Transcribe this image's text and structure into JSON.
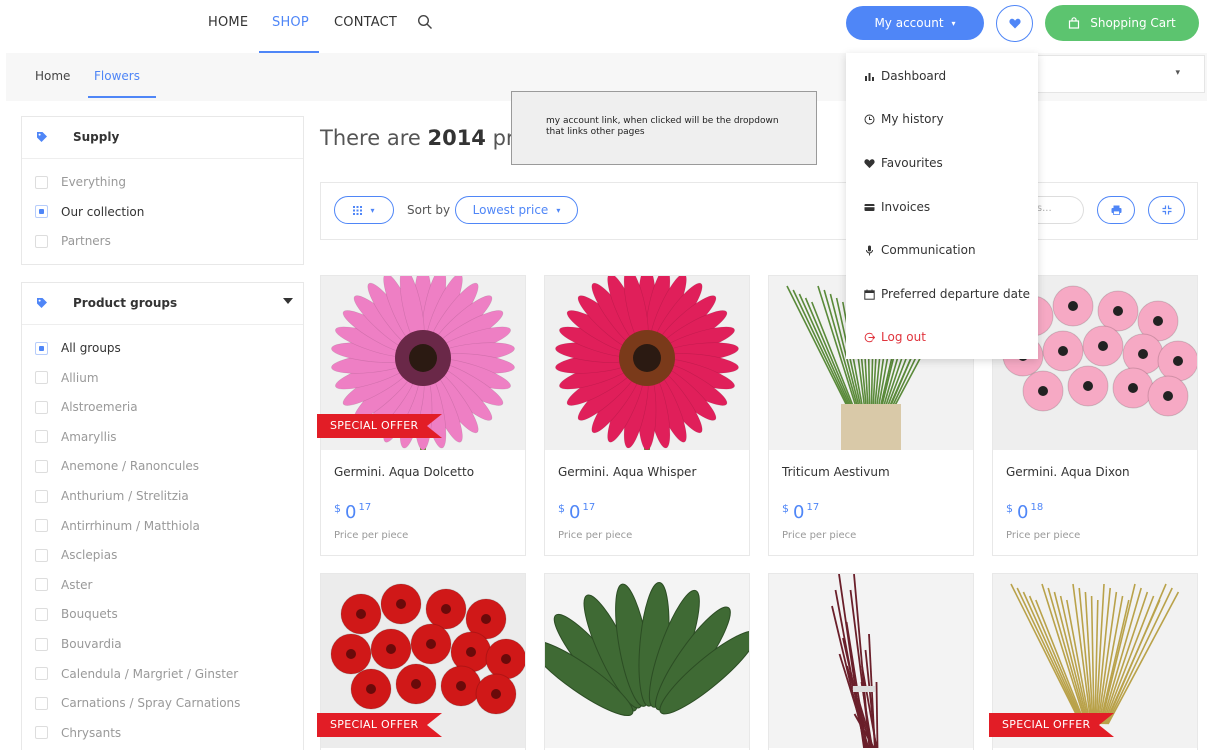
{
  "nav": {
    "links": [
      "HOME",
      "SHOP",
      "CONTACT"
    ],
    "account_label": "My account",
    "cart_label": "Shopping Cart"
  },
  "breadcrumb": [
    "Home",
    "Flowers"
  ],
  "sidebar": {
    "supply": {
      "title": "Supply",
      "options": [
        {
          "label": "Everything",
          "checked": false
        },
        {
          "label": "Our collection",
          "checked": true
        },
        {
          "label": "Partners",
          "checked": false
        }
      ]
    },
    "groups": {
      "title": "Product groups",
      "options": [
        {
          "label": "All groups",
          "checked": true
        },
        {
          "label": "Allium",
          "checked": false
        },
        {
          "label": "Alstroemeria",
          "checked": false
        },
        {
          "label": "Amaryllis",
          "checked": false
        },
        {
          "label": "Anemone / Ranoncules",
          "checked": false
        },
        {
          "label": "Anthurium / Strelitzia",
          "checked": false
        },
        {
          "label": "Antirrhinum / Matthiola",
          "checked": false
        },
        {
          "label": "Asclepias",
          "checked": false
        },
        {
          "label": "Aster",
          "checked": false
        },
        {
          "label": "Bouquets",
          "checked": false
        },
        {
          "label": "Bouvardia",
          "checked": false
        },
        {
          "label": "Calendula / Margriet / Ginster",
          "checked": false
        },
        {
          "label": "Carnations / Spray Carnations",
          "checked": false
        },
        {
          "label": "Chrysants",
          "checked": false
        }
      ]
    }
  },
  "main": {
    "headline_prefix": "There are ",
    "headline_count": "2014",
    "headline_suffix": " pro",
    "sort_label": "Sort by",
    "sort_value": "Lowest price",
    "search_stub": "ts...",
    "products": [
      {
        "name": "Germini. Aqua Dolcetto",
        "currency": "$",
        "price_main": "0",
        "price_cents": "17",
        "price_note": "Price per piece",
        "special": true
      },
      {
        "name": "Germini. Aqua Whisper",
        "currency": "$",
        "price_main": "0",
        "price_cents": "17",
        "price_note": "Price per piece",
        "special": false
      },
      {
        "name": "Triticum Aestivum",
        "currency": "$",
        "price_main": "0",
        "price_cents": "17",
        "price_note": "Price per piece",
        "special": false
      },
      {
        "name": "Germini. Aqua Dixon",
        "currency": "$",
        "price_main": "0",
        "price_cents": "18",
        "price_note": "Price per piece",
        "special": false
      },
      {
        "special": true
      },
      {
        "special": false
      },
      {
        "special": false
      },
      {
        "special": true
      }
    ],
    "special_label": "SPECIAL OFFER"
  },
  "account_menu": {
    "items": [
      {
        "label": "Dashboard",
        "icon": "chart-icon"
      },
      {
        "label": "My history",
        "icon": "clock-icon"
      },
      {
        "label": "Favourites",
        "icon": "heart-icon"
      },
      {
        "label": "Invoices",
        "icon": "credit-card-icon"
      },
      {
        "label": "Communication",
        "icon": "microphone-icon"
      },
      {
        "label": "Preferred departure date",
        "icon": "calendar-icon"
      },
      {
        "label": "Log out",
        "icon": "logout-icon"
      }
    ]
  },
  "note": {
    "line1": "my account link, when clicked will be the dropdown",
    "line2": "that links other pages"
  },
  "colors": {
    "accent": "#4f86f7",
    "cart": "#5cc46f",
    "special": "#e21d26"
  }
}
